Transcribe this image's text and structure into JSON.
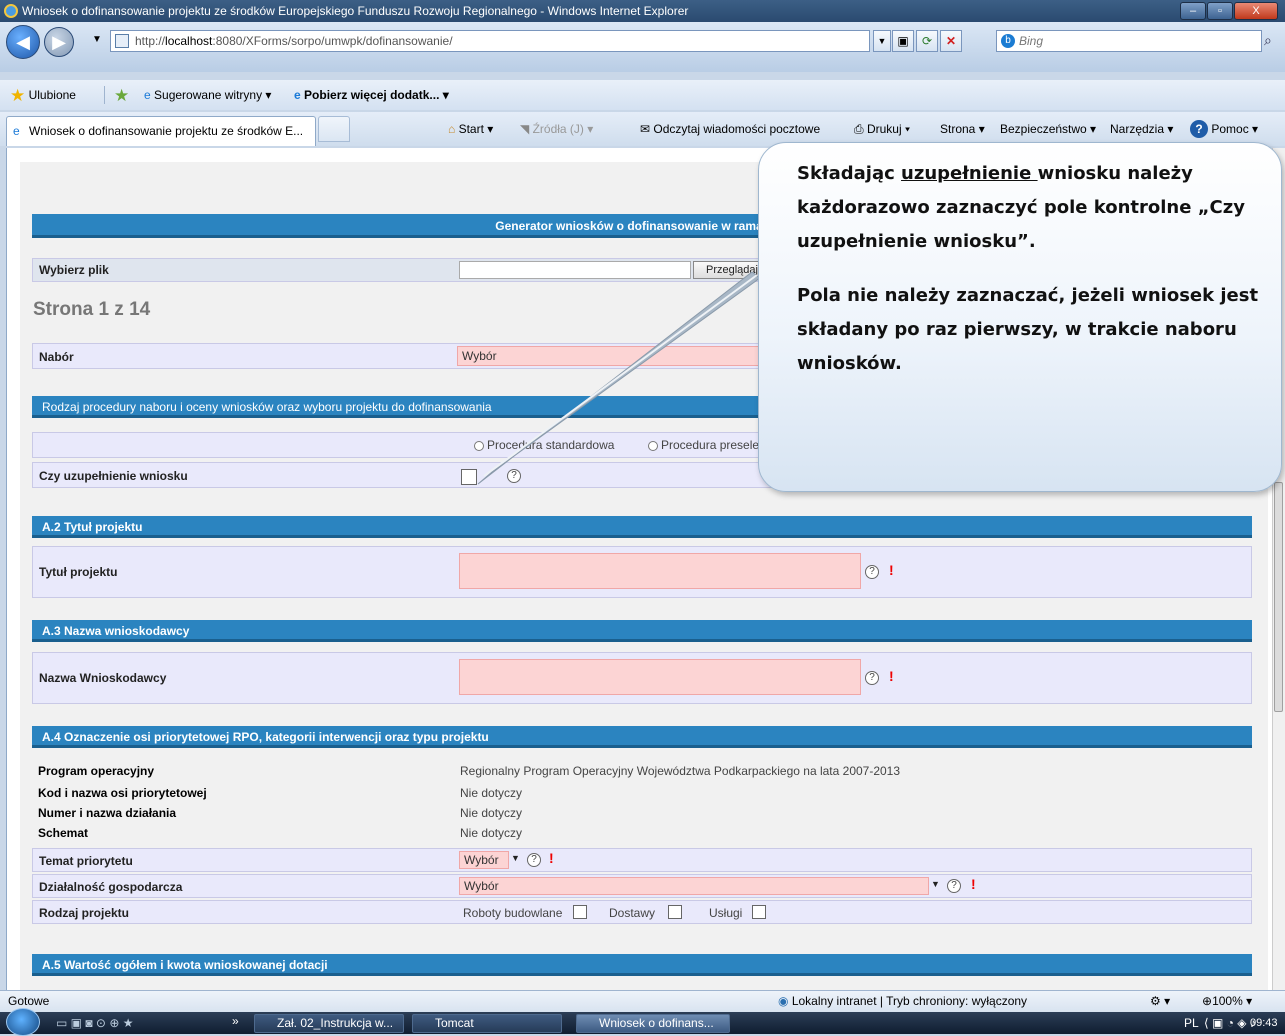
{
  "window": {
    "title": "Wniosek o dofinansowanie projektu ze środków Europejskiego Funduszu Rozwoju Regionalnego - Windows Internet Explorer",
    "buttons": [
      "–",
      "▫",
      "X"
    ]
  },
  "nav": {
    "address_prefix": "http://",
    "address_host": "localhost",
    "address_rest": ":8080/XForms/sorpo/umwpk/dofinansowanie/",
    "search_placeholder": "Bing"
  },
  "favorites": {
    "ulubione": "Ulubione",
    "sugerowane": "Sugerowane witryny ▾",
    "pobierz": "Pobierz więcej dodatk... ▾"
  },
  "tabs": {
    "active": "Wniosek o dofinansowanie projektu ze środków E...",
    "commands": [
      "Start ▾",
      "Źródła (J) ▾",
      "Odczytaj wiadomości pocztowe",
      "Drukuj ▾",
      "Strona ▾",
      "Bezpieczeństwo ▾",
      "Narzędzia ▾",
      "Pomoc ▾"
    ]
  },
  "form": {
    "generator_title": "Generator wniosków o dofinansowanie w ramach R",
    "file_label": "Wybierz plik",
    "browse_button": "Przeglądaj...",
    "page_indicator": "Strona 1 z 14",
    "nabor_label": "Nabór",
    "nabor_value": "Wybór",
    "procedure_header": "Rodzaj procedury naboru i oceny wniosków oraz wyboru projektu do dofinansowania",
    "radio_standard": "Procedura standardowa",
    "radio_preselect": "Procedura presele",
    "czy_uzup_label": "Czy uzupełnienie wniosku",
    "a2_header": "A.2 Tytuł projektu",
    "tytul_label": "Tytuł projektu",
    "a3_header": "A.3 Nazwa wnioskodawcy",
    "nazwa_label": "Nazwa Wnioskodawcy",
    "a4_header": "A.4 Oznaczenie osi priorytetowej RPO, kategorii interwencji oraz typu projektu",
    "a4_rows": [
      {
        "label": "Program operacyjny",
        "value": "Regionalny Program Operacyjny Województwa Podkarpackiego na lata 2007-2013"
      },
      {
        "label": "Kod i nazwa osi priorytetowej",
        "value": "Nie dotyczy"
      },
      {
        "label": "Numer i nazwa działania",
        "value": "Nie dotyczy"
      },
      {
        "label": "Schemat",
        "value": "Nie dotyczy"
      }
    ],
    "temat_label": "Temat priorytetu",
    "temat_value": "Wybór",
    "dzialalnosc_label": "Działalność gospodarcza",
    "dzialalnosc_value": "Wybór",
    "rodzaj_label": "Rodzaj projektu",
    "rodzaj_options": [
      "Roboty budowlane",
      "Dostawy",
      "Usługi"
    ],
    "a5_header": "A.5 Wartość ogółem i kwota wnioskowanej dotacji",
    "help_glyph": "?",
    "required_glyph": "!"
  },
  "callout": {
    "p1_before": "Składając ",
    "p1_underlined": "uzupełnienie ",
    "p1_after": "wniosku należy każdorazowo zaznaczyć pole kontrolne „Czy uzupełnienie wniosku”.",
    "p2": "Pola nie należy zaznaczać, jeżeli wniosek jest składany po raz pierwszy, w trakcie naboru wniosków."
  },
  "status": {
    "left": "Gotowe",
    "zone": "Lokalny intranet | Tryb chroniony: wyłączony",
    "zoom": "100%"
  },
  "taskbar": {
    "items": [
      "Zał. 02_Instrukcja w...",
      "Tomcat",
      "Wniosek o dofinans..."
    ],
    "lang": "PL",
    "clock": "09:43"
  }
}
